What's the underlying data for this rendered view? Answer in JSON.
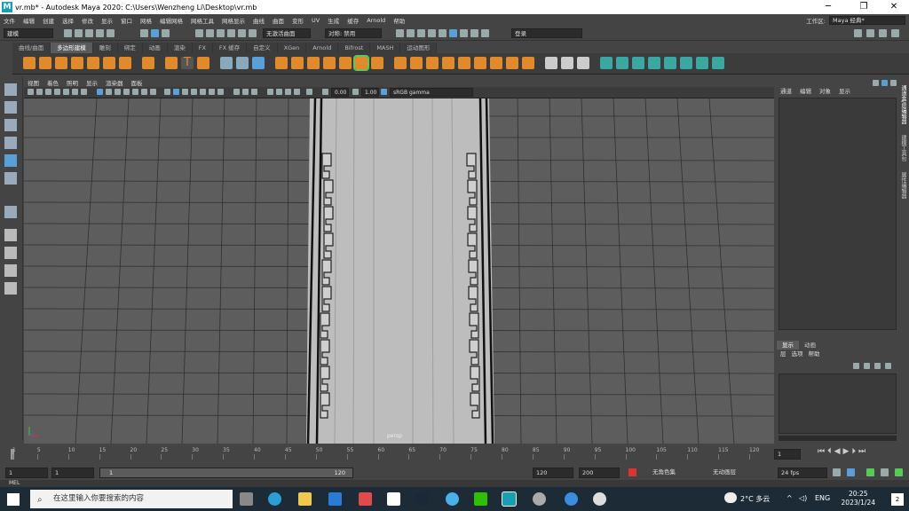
{
  "titlebar": {
    "title": "vr.mb* - Autodesk Maya 2020: C:\\Users\\Wenzheng Li\\Desktop\\vr.mb",
    "minimize": "─",
    "maximize": "❐",
    "close": "✕"
  },
  "menubar": {
    "items": [
      "文件",
      "编辑",
      "创建",
      "选择",
      "修改",
      "显示",
      "窗口",
      "网格",
      "编辑网格",
      "网格工具",
      "网格显示",
      "曲线",
      "曲面",
      "变形",
      "UV",
      "生成",
      "缓存",
      "Arnold",
      "帮助"
    ]
  },
  "workspace": {
    "label": "工作区:",
    "value": "Maya 经典*"
  },
  "statusline": {
    "mode": "建模",
    "live_surface": "无激活曲面",
    "symmetry": "对称: 禁用",
    "login": "登录"
  },
  "shelf_tabs": [
    "曲线/曲面",
    "多边形建模",
    "雕刻",
    "绑定",
    "动画",
    "渲染",
    "FX",
    "FX 缓存",
    "自定义",
    "XGen",
    "Arnold",
    "Bifrost",
    "MASH",
    "运动图形"
  ],
  "shelf_active": "多边形建模",
  "viewport": {
    "menu": [
      "视图",
      "着色",
      "照明",
      "显示",
      "渲染器",
      "面板"
    ],
    "exposure": "0.00",
    "gamma": "1.00",
    "color_space": "sRGB gamma",
    "camera_label": "persp"
  },
  "channel_box": {
    "tabs": [
      "通道",
      "编辑",
      "对象",
      "显示"
    ]
  },
  "vertical_tabs": [
    "通道盒/层编辑器",
    "建模工具包",
    "属性编辑器"
  ],
  "layer_editor": {
    "tabs": [
      "显示",
      "动画"
    ],
    "menu": [
      "层",
      "选项",
      "帮助"
    ]
  },
  "timeline": {
    "ticks": [
      "1",
      "5",
      "10",
      "15",
      "20",
      "25",
      "30",
      "35",
      "40",
      "45",
      "50",
      "55",
      "60",
      "65",
      "70",
      "75",
      "80",
      "85",
      "90",
      "95",
      "100",
      "105",
      "110",
      "115",
      "120"
    ],
    "current_frame": "1"
  },
  "range": {
    "start": "1",
    "inner_start": "1",
    "bar_start": "1",
    "bar_end": "120",
    "inner_end": "120",
    "end": "200",
    "character_set": "无角色集",
    "anim_layer": "无动画层",
    "fps": "24 fps"
  },
  "command_line": {
    "label": "MEL"
  },
  "taskbar": {
    "search_placeholder": "在这里输入你要搜索的内容",
    "weather": "2°C 多云",
    "lang": "ENG",
    "time": "20:25",
    "date": "2023/1/24",
    "notifications": "2"
  },
  "colors": {
    "maya_teal": "#17a0b3",
    "active_icon": "#5aa0d8",
    "viewport_bg": "#5d5d5d",
    "taskbar": "#1c2b36"
  }
}
